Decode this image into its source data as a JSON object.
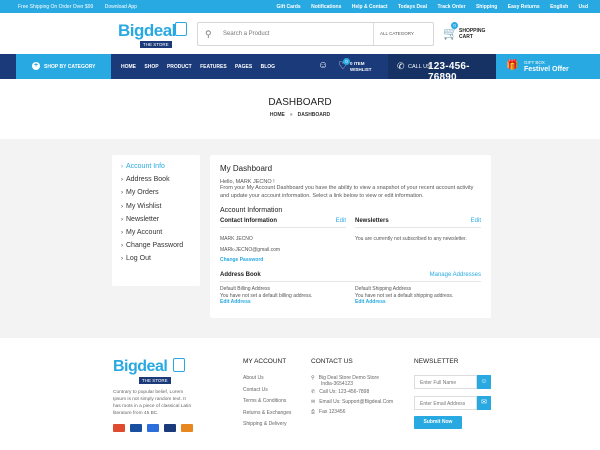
{
  "topbar": {
    "left": [
      "Free Shipping On Order Over $99",
      "Download App"
    ],
    "right": [
      "Gift Cards",
      "Notifications",
      "Help & Contact",
      "Todays Deal",
      "Track Order",
      "Shipping",
      "Easy Returns",
      "English",
      "Usd"
    ]
  },
  "logo": {
    "word": "Bigdeal",
    "tag": "THE STORE"
  },
  "search": {
    "placeholder": "Search a Product",
    "category": "ALL CATEGORY"
  },
  "cart": {
    "count": "0",
    "line1": "SHOPPING",
    "line2": "CART"
  },
  "nav": {
    "shop_by_category": "SHOP BY CATEGORY",
    "menu": [
      "HOME",
      "SHOP",
      "PRODUCT",
      "FEATURES",
      "PAGES",
      "BLOG"
    ],
    "wishlist_count": "0",
    "wishlist_line1": "0 ITEM",
    "wishlist_line2": "WISHLIST",
    "call_label": "CALL US",
    "phone": "123-456-76890",
    "gift_line1": "GIFT BOX",
    "gift_line2": "Festivel Offer"
  },
  "page": {
    "title": "DASHBOARD",
    "crumbs": [
      "HOME",
      "DASHBOARD"
    ],
    "sep": "»"
  },
  "sidebar": [
    "Account Info",
    "Address Book",
    "My Orders",
    "My Wishlist",
    "Newsletter",
    "My Account",
    "Change Password",
    "Log Out"
  ],
  "dashboard": {
    "title": "My Dashboard",
    "hello": "Hello, MARK JECNO !",
    "intro": "From your My Account Dashboard you have the ability to view a snapshot of your recent account activity and update your account information. Select a link below to view or edit information.",
    "account_info": "Account Information",
    "contact_title": "Contact Information",
    "edit": "Edit",
    "contact_name": "MARK JECNO",
    "contact_email": "MARk-JECNO@gmail.com",
    "change_password": "Change Password",
    "newsletters_title": "Newsletters",
    "newsletter_text": "You are currently not subscribed to any newsletter.",
    "address_book": "Address Book",
    "manage_addresses": "Manage Addresses",
    "billing_title": "Default Billing Address",
    "billing_text": "You have not set a default billing address.",
    "shipping_title": "Default Shipping Address",
    "shipping_text": "You have not set a default shipping address.",
    "edit_address": "Edit Address"
  },
  "footer": {
    "desc": "Contrary to popular belief, Lorem Ipsum is not simply random text. It has roots in a piece of classical Latin literature from 45 BC.",
    "my_account_title": "MY ACCOUNT",
    "my_account_links": [
      "About Us",
      "Contact Us",
      "Terms & Conditions",
      "Returns & Exchanges",
      "Shipping & Delivery"
    ],
    "contact_title": "CONTACT US",
    "address_line1": "Big Deal Store Demo Store",
    "address_line2": "India-3654123",
    "call": "Call Us: 123-456-7898",
    "email": "Email Us: Support@Bigdeal.Com",
    "fax": "Fax 123456",
    "newsletter_title": "NEWSLETTER",
    "name_placeholder": "Enter Full Name",
    "email_placeholder": "Enter Email Address",
    "submit": "Submit Now"
  },
  "colors": {
    "accent": "#29a9e1",
    "navy": "#1b3a7a",
    "content_bg": "#f3f3f3"
  }
}
